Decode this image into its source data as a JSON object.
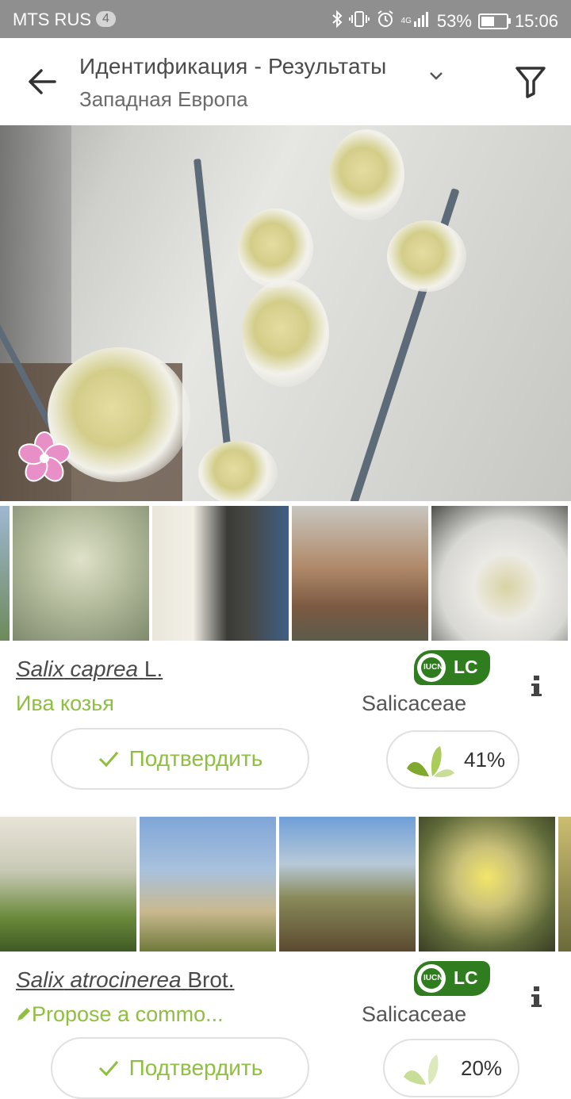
{
  "status_bar": {
    "carrier": "MTS RUS",
    "notification_count": "4",
    "network": "4G",
    "battery": "53%",
    "battery_level": 0.53,
    "time": "15:06",
    "icons": [
      "bluetooth-icon",
      "vibrate-icon",
      "alarm-icon",
      "signal-icon",
      "battery-icon"
    ]
  },
  "app_bar": {
    "title": "Идентификация - Результаты",
    "subtitle": "Западная Европа",
    "icons": [
      "back-arrow-icon",
      "chevron-down-icon",
      "filter-icon"
    ]
  },
  "hero": {
    "badge_icon": "flower-icon",
    "badge_color": "#e8a0d6"
  },
  "results": [
    {
      "genus": "Salix",
      "species": "caprea",
      "author": "L.",
      "common_name": "Ива козья",
      "family": "Salicaceae",
      "iucn_small": "IUCN",
      "iucn_status": "LC",
      "confirm_label": "Подтвердить",
      "score": "41%",
      "score_value": 0.41,
      "thumbnails": 5
    },
    {
      "genus": "Salix",
      "species": "atrocinerea",
      "author": "Brot.",
      "common_name": "Propose a commo...",
      "family": "Salicaceae",
      "iucn_small": "IUCN",
      "iucn_status": "LC",
      "confirm_label": "Подтвердить",
      "score": "20%",
      "score_value": 0.2,
      "thumbnails": 5
    }
  ],
  "colors": {
    "accent_green": "#8fbf3f",
    "iucn_green": "#2f7d1f",
    "status_bar": "#8f8f8f"
  }
}
